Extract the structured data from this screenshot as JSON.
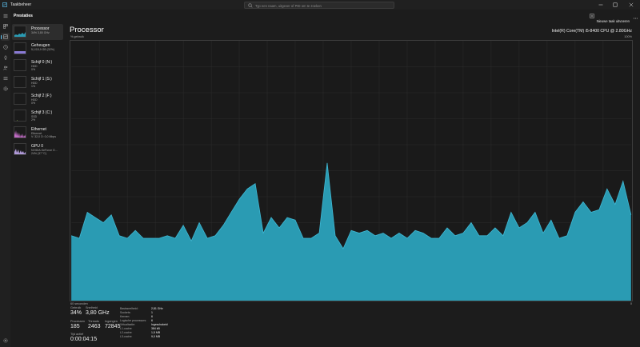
{
  "window": {
    "title": "Taakbeheer"
  },
  "search": {
    "placeholder": "Typ een naam, uitgever of PID om te zoeken"
  },
  "header": {
    "title": "Prestaties",
    "run_task_label": "Nieuwe taak uitvoeren"
  },
  "nav": [
    "menu-icon",
    "processes-icon",
    "performance-icon",
    "app-history-icon",
    "startup-apps-icon",
    "users-icon",
    "details-icon",
    "services-icon"
  ],
  "perf_items": [
    {
      "name": "Processor",
      "sub1": "34%  3,80 GHz",
      "sub2": "",
      "sub3": "",
      "thumb_color": "#2a9bb3"
    },
    {
      "name": "Geheugen",
      "sub1": "5,1/15,9 GB (32%)",
      "sub2": "",
      "sub3": "",
      "thumb_color": "#8a7ad6"
    },
    {
      "name": "Schijf 0 (N:)",
      "sub1": "HDD",
      "sub2": "0%",
      "sub3": "",
      "thumb_color": "#79a13a"
    },
    {
      "name": "Schijf 1 (S:)",
      "sub1": "HDD",
      "sub2": "1%",
      "sub3": "",
      "thumb_color": "#79a13a"
    },
    {
      "name": "Schijf 2 (F:)",
      "sub1": "HDD",
      "sub2": "0%",
      "sub3": "",
      "thumb_color": "#79a13a"
    },
    {
      "name": "Schijf 3 (C:)",
      "sub1": "SSD",
      "sub2": "2%",
      "sub3": "",
      "thumb_color": "#79a13a"
    },
    {
      "name": "Ethernet",
      "sub1": "Ethernet",
      "sub2": "V: 32,0  O: 0,0 Mbps",
      "sub3": "",
      "thumb_color": "#c06ac4"
    },
    {
      "name": "GPU 0",
      "sub1": "NVIDIA GeForce G...",
      "sub2": "24% (37 °C)",
      "sub3": "",
      "thumb_color": "#b09ad9"
    }
  ],
  "main": {
    "title": "Processor",
    "subtitle": "% gebruik",
    "cpu_model": "Intel(R) Core(TM) i5-8400 CPU @ 2.80GHz",
    "y_max_label": "100%",
    "x_start_label": "60 seconden",
    "x_end_label": "0"
  },
  "stats": {
    "usage_label": "Gebruik",
    "usage_value": "34%",
    "speed_label": "Snelheid",
    "speed_value": "3,80 GHz",
    "processes_label": "Processen",
    "processes_value": "185",
    "threads_label": "Threads",
    "threads_value": "2463",
    "handles_label": "Ingangen",
    "handles_value": "72845",
    "uptime_label": "Tijd actief",
    "uptime_value": "0:00:04:15"
  },
  "details": [
    {
      "label": "Basissnelheid:",
      "value": "2,81 GHz"
    },
    {
      "label": "Sockets:",
      "value": "1"
    },
    {
      "label": "Kernen:",
      "value": "6"
    },
    {
      "label": "Logische processors:",
      "value": "6"
    },
    {
      "label": "Virtualisatie:",
      "value": "Ingeschakeld"
    },
    {
      "label": "L1-cache:",
      "value": "384 kB"
    },
    {
      "label": "L2-cache:",
      "value": "1,5 MB"
    },
    {
      "label": "L3-cache:",
      "value": "9,0 MB"
    }
  ],
  "colors": {
    "accent": "#60cdff",
    "cpu_fill": "#2a9bb3",
    "cpu_line": "#3fb8d4",
    "background": "#1c1c1c"
  },
  "chart_data": {
    "type": "area",
    "title": "Processor",
    "ylabel": "% gebruik",
    "xlabel": "60 seconden",
    "ylim": [
      0,
      100
    ],
    "x": [
      60,
      59,
      58,
      57,
      56,
      55,
      54,
      53,
      52,
      51,
      50,
      49,
      48,
      47,
      46,
      45,
      44,
      43,
      42,
      41,
      40,
      39,
      38,
      37,
      36,
      35,
      34,
      33,
      32,
      31,
      30,
      29,
      28,
      27,
      26,
      25,
      24,
      23,
      22,
      21,
      20,
      19,
      18,
      17,
      16,
      15,
      14,
      13,
      12,
      11,
      10,
      9,
      8,
      7,
      6,
      5,
      4,
      3,
      2,
      1,
      0
    ],
    "values": [
      25,
      24,
      34,
      32,
      30,
      33,
      25,
      24,
      27,
      24,
      24,
      24,
      25,
      24,
      29,
      23,
      30,
      24,
      25,
      29,
      34,
      39,
      43,
      45,
      26,
      32,
      28,
      32,
      31,
      24,
      24,
      26,
      53,
      25,
      20,
      27,
      26,
      27,
      25,
      26,
      24,
      26,
      24,
      27,
      26,
      24,
      24,
      28,
      25,
      26,
      30,
      25,
      25,
      28,
      25,
      34,
      28,
      30,
      34,
      26,
      31,
      24,
      25,
      34,
      38,
      34,
      35,
      43,
      37,
      46,
      33
    ]
  }
}
